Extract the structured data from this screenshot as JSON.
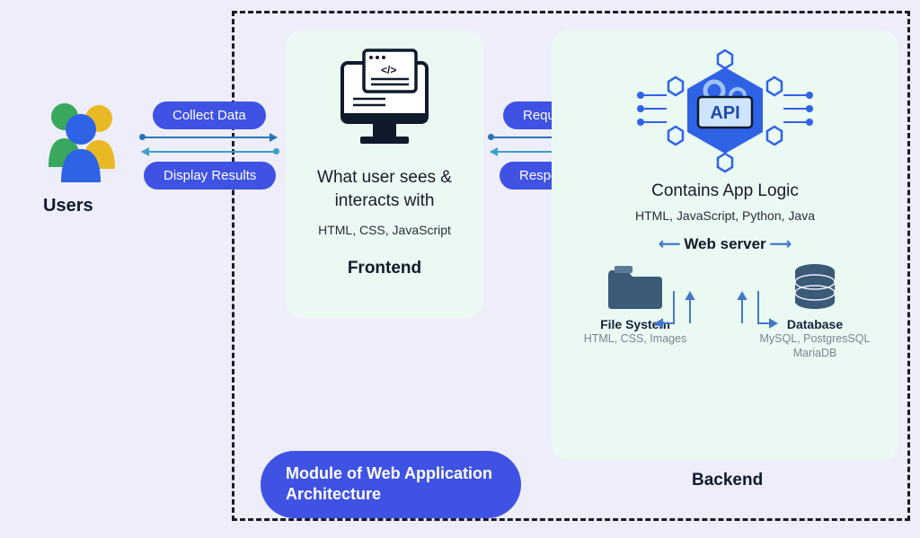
{
  "users_label": "Users",
  "arrows": {
    "collect": "Collect Data",
    "display": "Display Results",
    "request": "Request",
    "response": "Response"
  },
  "frontend": {
    "desc": "What user sees & interacts with",
    "tech": "HTML, CSS, JavaScript",
    "label": "Frontend"
  },
  "backend": {
    "title": "Contains App Logic",
    "tech": "HTML, JavaScript, Python, Java",
    "webserver": "Web server",
    "filesystem": {
      "title": "File System",
      "sub": "HTML, CSS, Images"
    },
    "database": {
      "title": "Database",
      "sub": "MySQL, PostgresSQL MariaDB"
    },
    "label": "Backend"
  },
  "diagram_title": "Module of Web Application Architecture",
  "api_badge": "API"
}
